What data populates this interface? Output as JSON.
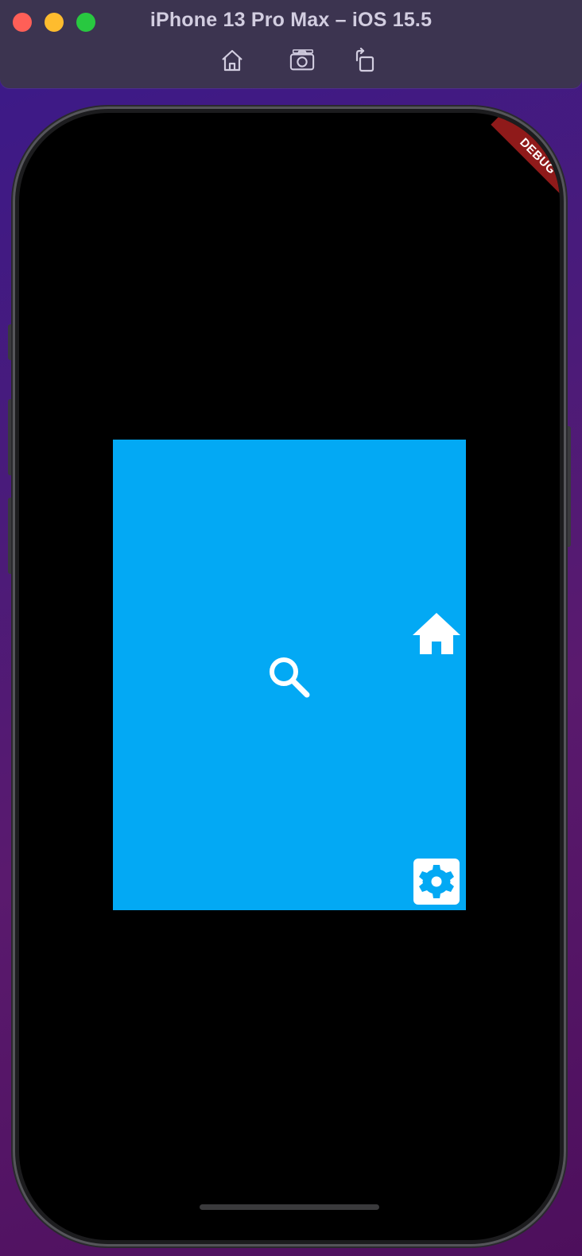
{
  "window": {
    "title": "iPhone 13 Pro Max – iOS 15.5"
  },
  "toolbar": {
    "home_icon": "home-icon",
    "screenshot_icon": "camera-icon",
    "rotate_icon": "rotate-icon"
  },
  "device": {
    "debug_banner": "DEBUG"
  },
  "app": {
    "panel_color": "#03a9f4",
    "icons": [
      "search-icon",
      "home-icon",
      "settings-icon"
    ]
  }
}
